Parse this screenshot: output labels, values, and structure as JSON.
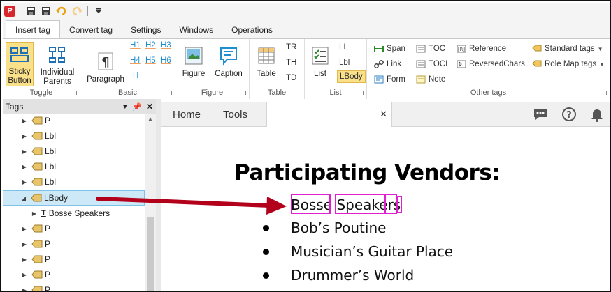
{
  "quick_access": {
    "app_logo": "P"
  },
  "ribbon_tabs": [
    "Insert tag",
    "Convert tag",
    "Settings",
    "Windows",
    "Operations"
  ],
  "groups": {
    "toggle": {
      "label": "Toggle",
      "sticky_line1": "Sticky",
      "sticky_line2": "Button",
      "individual_line1": "Individual",
      "individual_line2": "Parents"
    },
    "basic": {
      "label": "Basic",
      "paragraph": "Paragraph",
      "headings": [
        "H1",
        "H2",
        "H3",
        "H4",
        "H5",
        "H6",
        "H"
      ]
    },
    "figure": {
      "label": "Figure",
      "figure": "Figure",
      "caption": "Caption"
    },
    "table": {
      "label": "Table",
      "table": "Table",
      "tr": "TR",
      "th": "TH",
      "td": "TD"
    },
    "list": {
      "label": "List",
      "list": "List",
      "li": "LI",
      "lbl": "Lbl",
      "lbody": "LBody"
    },
    "other": {
      "label": "Other tags",
      "span": "Span",
      "link": "Link",
      "form": "Form",
      "toc": "TOC",
      "toci": "TOCI",
      "note": "Note",
      "reference": "Reference",
      "reversed": "ReversedChars",
      "standard": "Standard tags",
      "rolemap": "Role Map tags"
    }
  },
  "tags_panel": {
    "title": "Tags",
    "rows": [
      {
        "label": "P"
      },
      {
        "label": "Lbl"
      },
      {
        "label": "Lbl"
      },
      {
        "label": "Lbl"
      },
      {
        "label": "Lbl"
      },
      {
        "label": "LBody"
      },
      {
        "label": "Bosse Speakers"
      },
      {
        "label": "P"
      },
      {
        "label": "P"
      },
      {
        "label": "P"
      },
      {
        "label": "P"
      },
      {
        "label": "P"
      }
    ]
  },
  "document": {
    "tabs": {
      "home": "Home",
      "tools": "Tools"
    },
    "title": "Participating Vendors:",
    "items": [
      "Bosse Speakers",
      "Bob’s Poutine",
      "Musician’s Guitar Place",
      "Drummer’s World"
    ]
  },
  "colors": {
    "accent_selected": "#fbe08a",
    "tag_highlight": "#e020d0",
    "arrow": "#b3001b",
    "tree_selected": "#cde8f7"
  }
}
